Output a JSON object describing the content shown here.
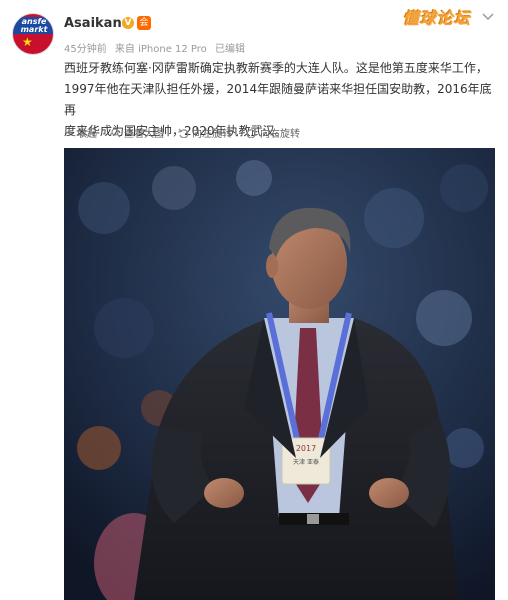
{
  "post": {
    "username": "Asaikana",
    "verify_badge": "V",
    "member_icon": "会",
    "time": "45分钟前",
    "source": "来自 iPhone 12 Pro",
    "edited": "已编辑",
    "content_lines": [
      "西班牙教练何塞·冈萨雷斯确定执教新赛季的大连人队。这是他第五度来华工作，",
      "1997年他在天津队担任外援，2014年跟随曼萨诺来华担任国安助教，2016年底再",
      "度来华成为国安主帅，2020年执教武汉。"
    ],
    "watermark": "懂球论坛",
    "avatar_logo": "ansfe markt"
  },
  "toolbar": {
    "collapse": "收起",
    "view_large": "查看大图",
    "rotate_left": "向左旋转",
    "rotate_right": "向右旋转"
  },
  "photo": {
    "badge_year": "2017",
    "badge_label": "天津 亚泰",
    "subject": "coach-on-sideline"
  },
  "colors": {
    "accent": "#ff8200",
    "meta_text": "#999999",
    "photo_bg": "#1a2436"
  }
}
